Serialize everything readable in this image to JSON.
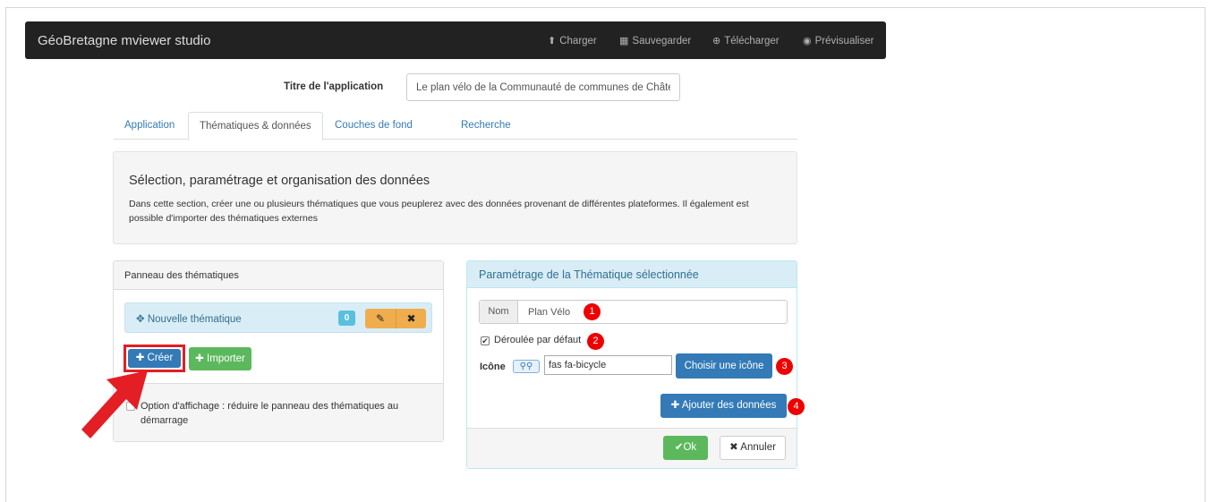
{
  "navbar": {
    "brand": "GéoBretagne mviewer studio",
    "items": [
      {
        "label": "Charger",
        "icon": "upload-icon",
        "glyph": "⬆"
      },
      {
        "label": "Sauvegarder",
        "icon": "save-icon",
        "glyph": "▦"
      },
      {
        "label": "Télécharger",
        "icon": "download-icon",
        "glyph": "⊕"
      },
      {
        "label": "Prévisualiser",
        "icon": "globe-icon",
        "glyph": "◉"
      }
    ]
  },
  "app_title": {
    "label": "Titre de l'application",
    "value": "Le plan vélo de la Communauté de communes de Châte"
  },
  "tabs": [
    {
      "label": "Application"
    },
    {
      "label": "Thématiques & données"
    },
    {
      "label": "Couches de fond"
    },
    {
      "label": "Recherche"
    }
  ],
  "intro": {
    "title": "Sélection, paramétrage et organisation des données",
    "description": "Dans cette section, créer une ou plusieurs thématiques que vous peuplerez avec des données provenant de différentes plateformes. Il également est possible d'importer des thématiques externes"
  },
  "themes_panel": {
    "title": "Panneau des thématiques",
    "items": [
      {
        "name": "Nouvelle thématique",
        "count": "0"
      }
    ],
    "create_label": "Créer",
    "import_label": "Importer",
    "option_label": "Option d'affichage : réduire le panneau des thématiques au démarrage"
  },
  "theme_settings": {
    "title": "Paramétrage de la Thématique sélectionnée",
    "nom_label": "Nom",
    "nom_value": "Plan Vélo",
    "deroulee_label": "Déroulée par défaut",
    "icone_label": "Icône",
    "icone_value": "fas fa-bicycle",
    "choose_icon_label": "Choisir une icône",
    "add_data_label": "Ajouter des données",
    "ok_label": "Ok",
    "cancel_label": "Annuler",
    "markers": [
      "1",
      "2",
      "3",
      "4"
    ]
  },
  "colors": {
    "navbar": "#222222",
    "primary": "#337ab7",
    "success": "#5cb85c",
    "warning": "#f0ad4e",
    "info": "#5bc0de",
    "highlight_red": "#e31e24"
  }
}
